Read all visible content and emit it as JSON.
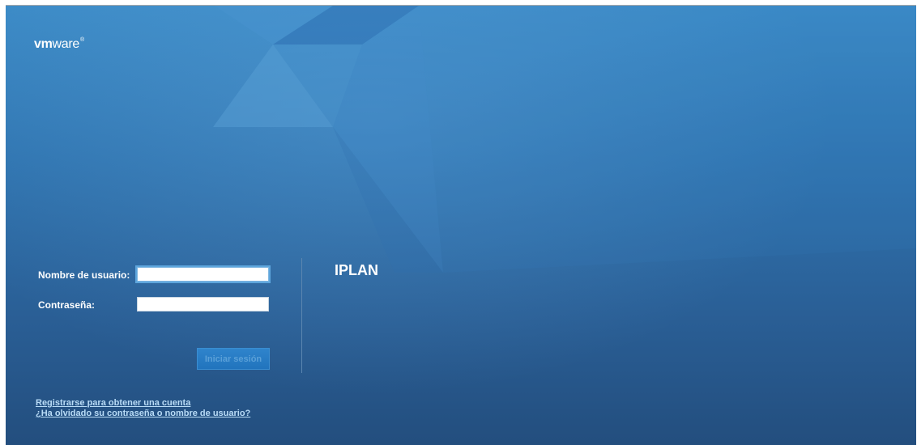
{
  "brand": {
    "logo_vm": "vm",
    "logo_ware": "ware",
    "logo_tm": "®"
  },
  "login_form": {
    "username_label": "Nombre de usuario:",
    "username_value": "",
    "password_label": "Contraseña:",
    "password_value": "",
    "submit_label": "Iniciar sesión"
  },
  "tenant": {
    "name": "IPLAN"
  },
  "links": {
    "register": "Registrarse para obtener una cuenta",
    "forgot": "¿Ha olvidado su contraseña o nombre de usuario?"
  },
  "colors": {
    "background_top": "#3b8ac6",
    "background_bottom": "#234e7e",
    "link": "#b9dcf7",
    "button": "#2174bd"
  }
}
